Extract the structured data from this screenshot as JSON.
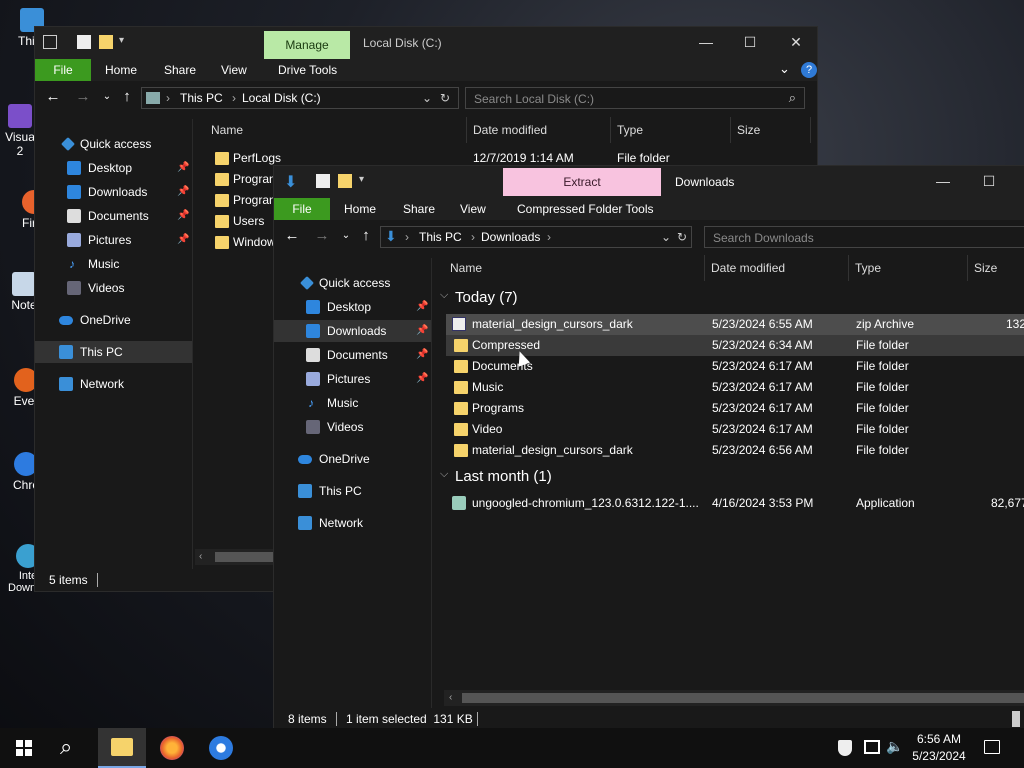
{
  "desktop": {
    "icons": [
      {
        "label": "Thi"
      },
      {
        "label": "Visua\n2"
      },
      {
        "label": "Fir"
      },
      {
        "label": "Note"
      },
      {
        "label": "Ever"
      },
      {
        "label": "Chro"
      },
      {
        "label": "Inte\nDownlo..."
      }
    ]
  },
  "back_window": {
    "title": "Local Disk (C:)",
    "context_tab": "Manage",
    "ribbon": {
      "file": "File",
      "home": "Home",
      "share": "Share",
      "view": "View",
      "tools": "Drive Tools"
    },
    "address": {
      "root": "This PC",
      "current": "Local Disk (C:)"
    },
    "search_placeholder": "Search Local Disk (C:)",
    "nav": [
      "Quick access",
      "Desktop",
      "Downloads",
      "Documents",
      "Pictures",
      "Music",
      "Videos",
      "OneDrive",
      "This PC",
      "Network"
    ],
    "columns": {
      "name": "Name",
      "date": "Date modified",
      "type": "Type",
      "size": "Size"
    },
    "rows": [
      {
        "name": "PerfLogs",
        "date": "12/7/2019 1:14 AM",
        "type": "File folder"
      },
      {
        "name": "Progran"
      },
      {
        "name": "Progran"
      },
      {
        "name": "Users"
      },
      {
        "name": "Window"
      }
    ],
    "status": "5 items"
  },
  "front_window": {
    "title": "Downloads",
    "context_tab": "Extract",
    "ribbon": {
      "file": "File",
      "home": "Home",
      "share": "Share",
      "view": "View",
      "tools": "Compressed Folder Tools"
    },
    "address": {
      "root": "This PC",
      "current": "Downloads"
    },
    "search_placeholder": "Search Downloads",
    "nav": [
      "Quick access",
      "Desktop",
      "Downloads",
      "Documents",
      "Pictures",
      "Music",
      "Videos",
      "OneDrive",
      "This PC",
      "Network"
    ],
    "columns": {
      "name": "Name",
      "date": "Date modified",
      "type": "Type",
      "size": "Size"
    },
    "groups": {
      "today": {
        "label": "Today (7)"
      },
      "last_month": {
        "label": "Last month (1)"
      }
    },
    "rows_today": [
      {
        "name": "material_design_cursors_dark",
        "date": "5/23/2024 6:55 AM",
        "type": "zip Archive",
        "size": "132"
      },
      {
        "name": "Compressed",
        "date": "5/23/2024 6:34 AM",
        "type": "File folder"
      },
      {
        "name": "Documents",
        "date": "5/23/2024 6:17 AM",
        "type": "File folder"
      },
      {
        "name": "Music",
        "date": "5/23/2024 6:17 AM",
        "type": "File folder"
      },
      {
        "name": "Programs",
        "date": "5/23/2024 6:17 AM",
        "type": "File folder"
      },
      {
        "name": "Video",
        "date": "5/23/2024 6:17 AM",
        "type": "File folder"
      },
      {
        "name": "material_design_cursors_dark",
        "date": "5/23/2024 6:56 AM",
        "type": "File folder"
      }
    ],
    "rows_last_month": [
      {
        "name": "ungoogled-chromium_123.0.6312.122-1....",
        "date": "4/16/2024 3:53 PM",
        "type": "Application",
        "size": "82,677"
      }
    ],
    "status": {
      "count": "8 items",
      "selected": "1 item selected  131 KB"
    }
  },
  "taskbar": {
    "time": "6:56 AM",
    "date": "5/23/2024"
  },
  "colors": {
    "file_tab": "#3c9a1f",
    "manage_tab": "#b9e9a6",
    "extract_tab": "#f8c3df",
    "folder": "#f6d36b"
  }
}
